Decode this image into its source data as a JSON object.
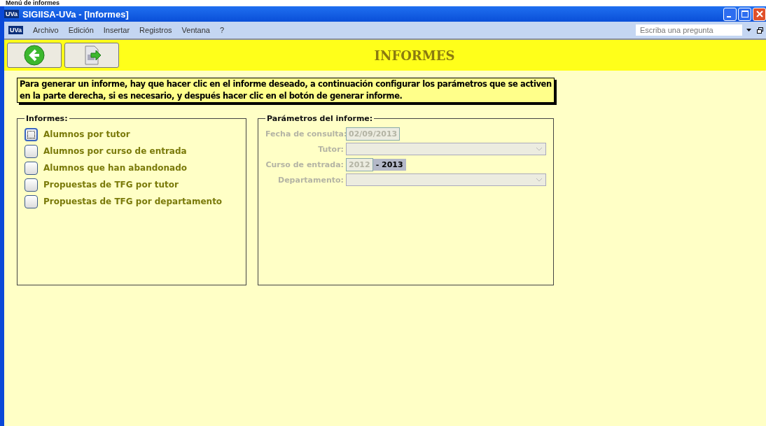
{
  "page_heading": "Menú de informes",
  "window": {
    "title": "SIGIISA-UVa - [Informes]",
    "app_badge": "UVa"
  },
  "menu_bar": {
    "badge": "UVa",
    "items": [
      "Archivo",
      "Edición",
      "Insertar",
      "Registros",
      "Ventana",
      "?"
    ],
    "help_search": {
      "placeholder": "Escriba una pregunta"
    }
  },
  "toolbar": {
    "title": "INFORMES"
  },
  "instructions": "Para generar un informe, hay que hacer clic en el informe deseado, a continuación configurar los parámetros que se activen en la parte derecha, si es necesario, y después hacer clic en el botón de generar informe.",
  "reports": {
    "legend": "Informes:",
    "items": [
      {
        "label": "Alumnos por tutor",
        "selected": true
      },
      {
        "label": "Alumnos por curso de entrada",
        "selected": false
      },
      {
        "label": "Alumnos que han abandonado",
        "selected": false
      },
      {
        "label": "Propuestas de TFG por tutor",
        "selected": false
      },
      {
        "label": "Propuestas de TFG por departamento",
        "selected": false
      }
    ]
  },
  "parameters": {
    "legend": "Parámetros del informe:",
    "fields": [
      {
        "kind": "text",
        "label": "Fecha de consulta:",
        "value": "02/09/2013",
        "disabled": true
      },
      {
        "kind": "select",
        "label": "Tutor:",
        "disabled": true
      },
      {
        "kind": "range",
        "label": "Curso de entrada:",
        "value": "2012",
        "suffix": "- 2013",
        "disabled": true
      },
      {
        "kind": "select",
        "label": "Departamento:",
        "disabled": true
      }
    ]
  }
}
